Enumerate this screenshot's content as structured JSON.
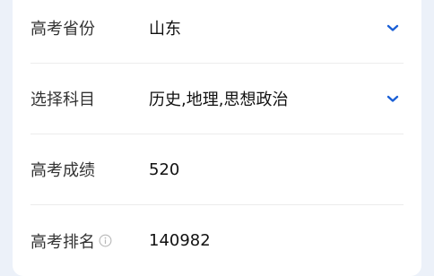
{
  "form": {
    "province": {
      "label": "高考省份",
      "value": "山东",
      "icon": "chevron-down-icon"
    },
    "subjects": {
      "label": "选择科目",
      "value": "历史,地理,思想政治",
      "icon": "chevron-down-icon"
    },
    "score": {
      "label": "高考成绩",
      "value": "520"
    },
    "rank": {
      "label": "高考排名",
      "value": "140982",
      "icon": "info-icon"
    }
  },
  "colors": {
    "accent": "#1a5fd6",
    "background": "#ecf1f9",
    "card": "#ffffff",
    "divider": "#ececec",
    "info_icon": "#b8b8b8"
  }
}
